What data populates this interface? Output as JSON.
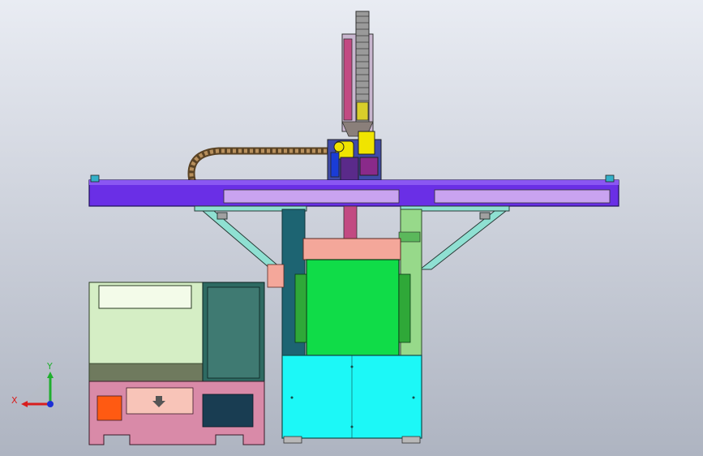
{
  "window": {
    "background_top": "#e9ecf3",
    "background_bottom": "#aeb4c1"
  },
  "triad": {
    "x_label": "X",
    "y_label": "Y",
    "x_color": "#d81e1e",
    "y_color": "#1fae2e",
    "z_color": "#1c2fd6"
  },
  "parts": [
    {
      "name": "vertical-z-axis-carriage",
      "color": "#c9b6cf"
    },
    {
      "name": "horizontal-beam",
      "color": "#6a2fe6"
    },
    {
      "name": "beam-cover-plate",
      "color": "#c9a3f0"
    },
    {
      "name": "cable-drag-chain",
      "color": "#8b6a3c"
    },
    {
      "name": "gripper-head",
      "color": "#f0e400"
    },
    {
      "name": "support-brackets",
      "color": "#8fe0d2"
    },
    {
      "name": "left-column",
      "color": "#1d6472"
    },
    {
      "name": "right-column",
      "color": "#97d98a"
    },
    {
      "name": "salmon-slide-plate",
      "color": "#f4a79a"
    },
    {
      "name": "green-machine-block",
      "color": "#10dc48"
    },
    {
      "name": "cyan-base-cabinet",
      "color": "#1cf8f7"
    },
    {
      "name": "control-cabinet",
      "color": "#d5eec5"
    },
    {
      "name": "pink-base",
      "color": "#d98aa8"
    }
  ]
}
